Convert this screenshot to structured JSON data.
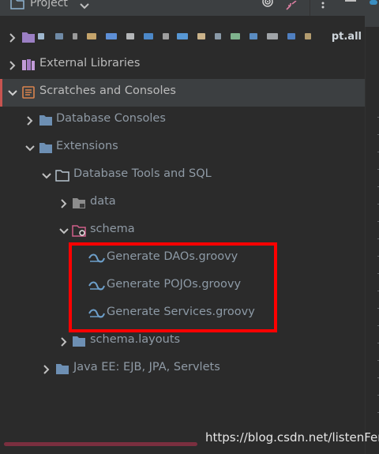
{
  "toolbar": {
    "title": "Project",
    "icons": [
      "folder-icon",
      "chevron-down-icon",
      "target-icon",
      "collapse-icon",
      "more-dots-icon",
      "minimize-icon"
    ]
  },
  "tree": {
    "project_root_suffix": "pt.all",
    "external_libraries": "External Libraries",
    "scratches": "Scratches and Consoles",
    "database_consoles": "Database Consoles",
    "extensions": "Extensions",
    "db_tools": "Database Tools and SQL",
    "data": "data",
    "schema": "schema",
    "gen_daos": "Generate DAOs.groovy",
    "gen_pojos": "Generate POJOs.groovy",
    "gen_services": "Generate Services.groovy",
    "schema_layouts": "schema.layouts",
    "java_ee": "Java EE: EJB, JPA, Servlets"
  },
  "colors": {
    "background": "#2b2b2b",
    "selected_row": "#3c3f41",
    "folder": "#6d8fb3",
    "annotation": "#ff0000"
  },
  "watermark": "https://blog.csdn.net/listenFen"
}
